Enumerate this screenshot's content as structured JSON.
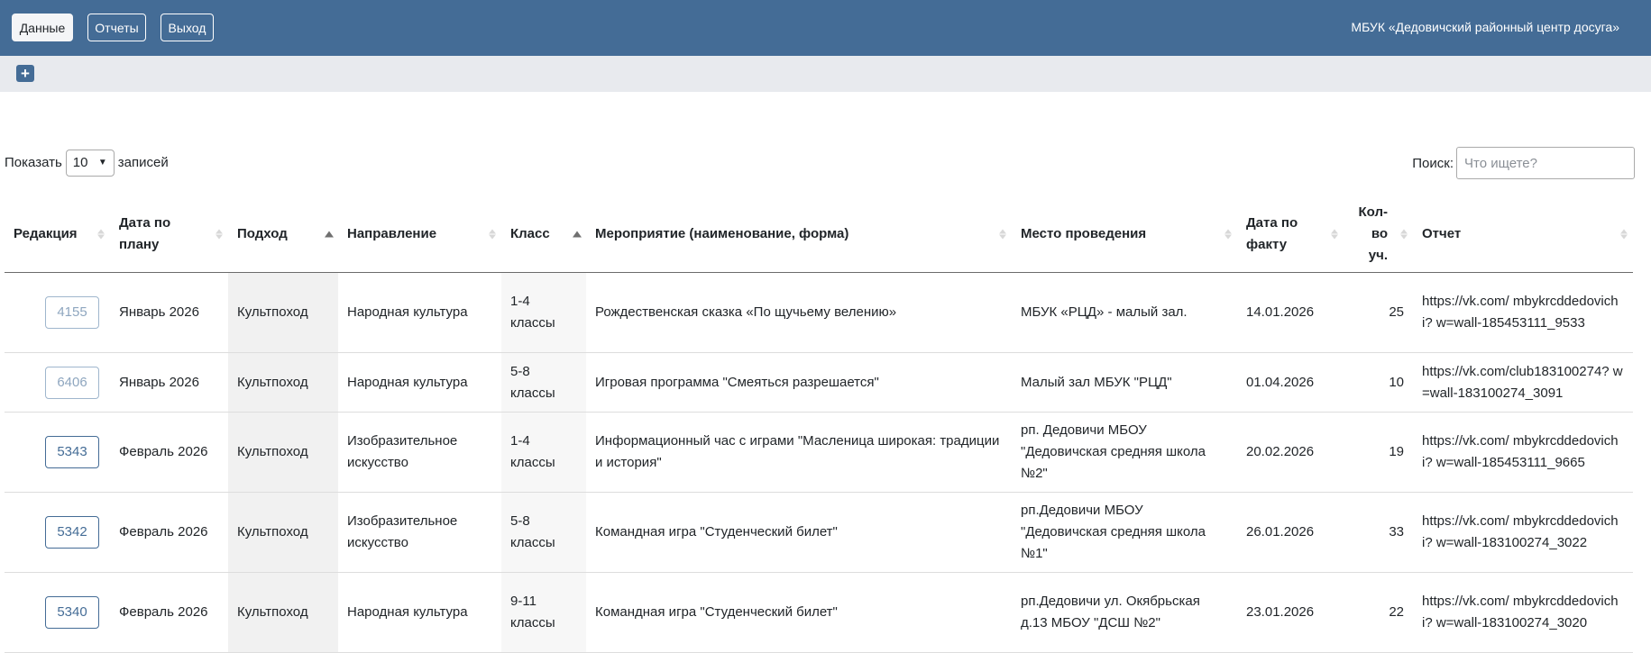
{
  "nav": {
    "data_label": "Данные",
    "reports_label": "Отчеты",
    "exit_label": "Выход",
    "org_name": "МБУК «Дедовичский районный центр досуга»"
  },
  "toolbar": {
    "add_label": "+"
  },
  "length": {
    "show_label": "Показать",
    "value": "10",
    "records_label": "записей"
  },
  "search": {
    "label": "Поиск:",
    "placeholder": "Что ищете?",
    "value": ""
  },
  "table": {
    "headers": {
      "edit": "Редакция",
      "plan_date": "Дата по плану",
      "approach": "Подход",
      "direction": "Направление",
      "class": "Класс",
      "event": "Мероприятие (наименование, форма)",
      "place": "Место проведения",
      "fact_date": "Дата по факту",
      "count": "Кол-во уч.",
      "report": "Отчет"
    },
    "rows": [
      {
        "id": "4155",
        "muted": true,
        "plan_date": "Январь 2026",
        "approach": "Культпоход",
        "direction": "Народная культура",
        "class": "1-4 классы",
        "event": "Рождественская сказка «По щучьему велению»",
        "place": "МБУК «РЦД» - малый зал.",
        "fact_date": "14.01.2026",
        "count": "25",
        "report": "https://vk.com/ mbykrcddedovichi? w=wall-185453111_9533"
      },
      {
        "id": "6406",
        "muted": true,
        "plan_date": "Январь 2026",
        "approach": "Культпоход",
        "direction": "Народная культура",
        "class": "5-8 классы",
        "event": "Игровая программа \"Смеяться разрешается\"",
        "place": "Малый зал МБУК \"РЦД\"",
        "fact_date": "01.04.2026",
        "count": "10",
        "report": "https://vk.com/club183100274? w=wall-183100274_3091"
      },
      {
        "id": "5343",
        "muted": false,
        "plan_date": "Февраль 2026",
        "approach": "Культпоход",
        "direction": "Изобразительное искусство",
        "class": "1-4 классы",
        "event": "Информационный час с играми \"Масленица широкая: традиции и история\"",
        "place": "рп. Дедовичи МБОУ \"Дедовичская средняя школа №2\"",
        "fact_date": "20.02.2026",
        "count": "19",
        "report": "https://vk.com/ mbykrcddedovichi? w=wall-185453111_9665"
      },
      {
        "id": "5342",
        "muted": false,
        "plan_date": "Февраль 2026",
        "approach": "Культпоход",
        "direction": "Изобразительное искусство",
        "class": "5-8 классы",
        "event": "Командная игра \"Студенческий билет\"",
        "place": "рп.Дедовичи МБОУ \"Дедовичская средняя школа №1\"",
        "fact_date": "26.01.2026",
        "count": "33",
        "report": "https://vk.com/ mbykrcddedovichi? w=wall-183100274_3022"
      },
      {
        "id": "5340",
        "muted": false,
        "plan_date": "Февраль 2026",
        "approach": "Культпоход",
        "direction": "Народная культура",
        "class": "9-11 классы",
        "event": "Командная игра \"Студенческий билет\"",
        "place": "рп.Дедовичи ул. Окябрьская д.13 МБОУ \"ДСШ №2\"",
        "fact_date": "23.01.2026",
        "count": "22",
        "report": "https://vk.com/ mbykrcddedovichi? w=wall-183100274_3020"
      }
    ]
  },
  "colors": {
    "topbar": "#446c96",
    "subbar": "#e8eaee",
    "accent": "#446c96"
  },
  "icons": {
    "add": "plus-icon",
    "sort": "sort-arrows-icon",
    "select": "chevron-down-icon"
  }
}
